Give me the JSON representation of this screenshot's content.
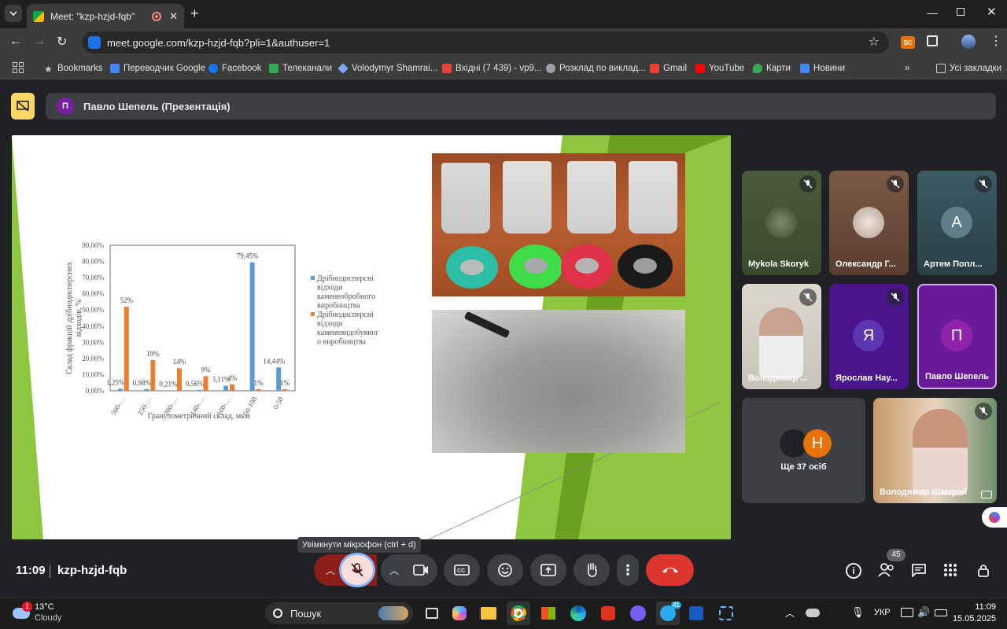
{
  "browser": {
    "tab_title": "Meet: \"kzp-hzjd-fqb\"",
    "url": "meet.google.com/kzp-hzjd-fqb?pli=1&authuser=1",
    "bookmarks": [
      "Bookmarks",
      "Переводчик Google",
      "Facebook",
      "Телеканали",
      "Volodymyr Shamrai...",
      "Вхідні (7 439) - vp9...",
      "Розклад по виклад...",
      "Gmail",
      "YouTube",
      "Карти",
      "Новини"
    ],
    "all_bookmarks": "Усі закладки",
    "ext_badge": "SC"
  },
  "presentation": {
    "avatar_letter": "П",
    "title": "Павло Шепель (Презентація)"
  },
  "chart_data": {
    "type": "bar",
    "ylabel": "Склад фракцій дрібнодисперсних відходів, %",
    "xlabel": "Гранулометричний склад, мкм",
    "ylim": [
      0,
      90
    ],
    "yticks": [
      "0,00%",
      "10,00%",
      "20,00%",
      "30,00%",
      "40,00%",
      "50,00%",
      "60,00%",
      "70,00%",
      "80,00%",
      "90,00%"
    ],
    "categories": [
      "500-…",
      "250-…",
      "200-…",
      "140-…",
      "100-…",
      "50-100",
      "0-50"
    ],
    "series": [
      {
        "name": "Дрібнодисперсні відходи каменеобробного виробництва",
        "color": "#5b9bd5",
        "values": [
          1.25,
          0.98,
          0.21,
          0.56,
          3.11,
          79.45,
          14.44
        ],
        "labels": [
          "1,25%",
          "0,98%",
          "0,21%",
          "0,56%",
          "3,11%",
          "79,45%",
          "14,44%"
        ]
      },
      {
        "name": "Дрібнодисперсні відходи каменевидобувного виробництва",
        "color": "#ed7d31",
        "values": [
          52,
          19,
          14,
          9,
          4,
          1,
          1
        ],
        "labels": [
          "52%",
          "19%",
          "14%",
          "9%",
          "4%",
          "1%",
          "1%"
        ]
      }
    ]
  },
  "participants": [
    {
      "name": "Mykola Skoryk",
      "muted": true
    },
    {
      "name": "Олександр Г...",
      "muted": true
    },
    {
      "name": "Артем Попл...",
      "muted": true,
      "letter": "А"
    },
    {
      "name": "Володимир ...",
      "muted": true
    },
    {
      "name": "Ярослав Нау...",
      "muted": true,
      "letter": "Я"
    },
    {
      "name": "Павло Шепель",
      "muted": false,
      "letter": "П"
    },
    {
      "name": "Ще 37 осіб",
      "letter": "Н"
    },
    {
      "name": "Володимир Шамрай",
      "muted": true
    }
  ],
  "controls": {
    "tooltip": "Увімкнути мікрофон (ctrl + d)",
    "time": "11:09",
    "meeting_code": "kzp-hzjd-fqb",
    "people_count": "45"
  },
  "taskbar": {
    "weather_temp": "13°C",
    "weather_desc": "Cloudy",
    "weather_badge": "1",
    "search": "Пошук",
    "telegram_badge": "41",
    "lang": "УКР",
    "clock_time": "11:09",
    "clock_date": "15.05.2025"
  }
}
